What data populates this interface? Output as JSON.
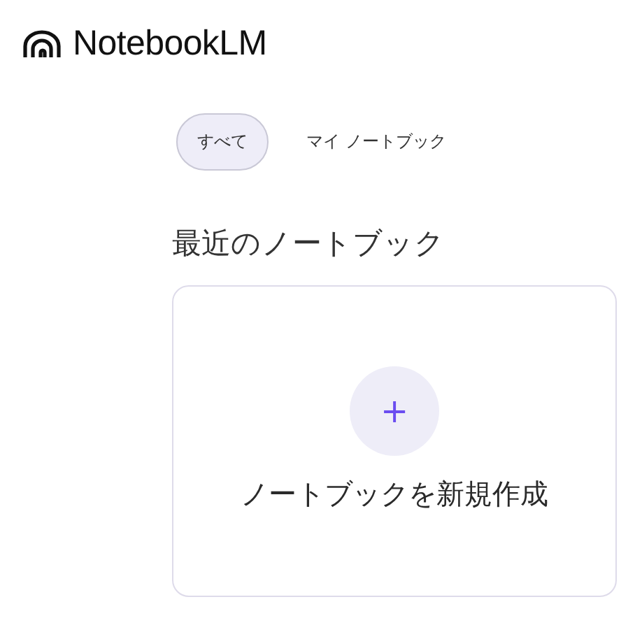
{
  "header": {
    "app_name": "NotebookLM"
  },
  "tabs": [
    {
      "label": "すべて",
      "selected": true
    },
    {
      "label": "マイ ノートブック",
      "selected": false
    }
  ],
  "section": {
    "title": "最近のノートブック"
  },
  "create_card": {
    "icon": "+",
    "label": "ノートブックを新規作成"
  }
}
